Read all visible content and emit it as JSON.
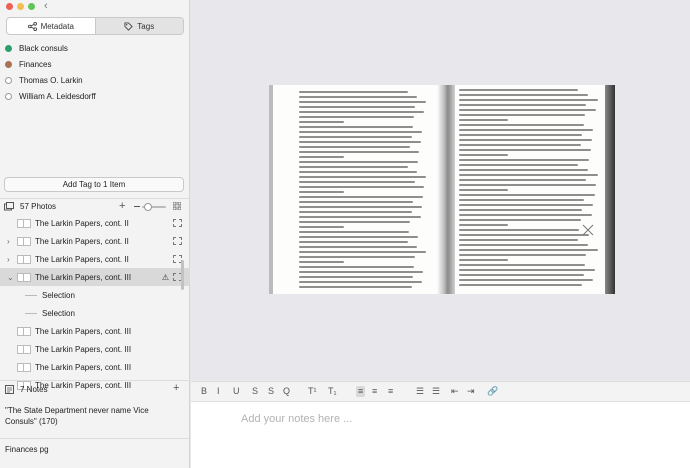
{
  "window": {
    "traffic_colors": [
      "#ee5f57",
      "#f4bd4f",
      "#60c554"
    ],
    "back_icon": "chevron-left-icon",
    "back_glyph": "‹"
  },
  "sidebar": {
    "tabs": [
      {
        "label": "Metadata",
        "icon": "share-nodes-icon",
        "active": false
      },
      {
        "label": "Tags",
        "icon": "tag-icon",
        "active": true
      }
    ],
    "tags": [
      {
        "label": "Black consuls",
        "color": "#2e9e6e",
        "filled": true
      },
      {
        "label": "Finances",
        "color": "#a87355",
        "filled": true
      },
      {
        "label": "Thomas O. Larkin",
        "color": "#ffffff",
        "filled": false
      },
      {
        "label": "William A. Leidesdorff",
        "color": "#ffffff",
        "filled": false
      }
    ],
    "add_tag_label": "Add Tag to 1 Item",
    "photos": {
      "count_label": "57 Photos",
      "plus": "+",
      "rows": [
        {
          "label": "The Larkin Papers, cont. II",
          "indent": 0,
          "chevron": "",
          "selected": false,
          "warn": false,
          "box": true
        },
        {
          "label": "The Larkin Papers, cont. II",
          "indent": 1,
          "chevron": "›",
          "selected": false,
          "warn": false,
          "box": true
        },
        {
          "label": "The Larkin Papers, cont. II",
          "indent": 1,
          "chevron": "›",
          "selected": false,
          "warn": false,
          "box": true
        },
        {
          "label": "The Larkin Papers, cont. III",
          "indent": 1,
          "chevron": "⌄",
          "selected": true,
          "warn": true,
          "box": true
        },
        {
          "label": "Selection",
          "indent": 2,
          "chevron": "",
          "selected": false,
          "warn": false,
          "box": false
        },
        {
          "label": "Selection",
          "indent": 2,
          "chevron": "",
          "selected": false,
          "warn": false,
          "box": false
        },
        {
          "label": "The Larkin Papers, cont. III",
          "indent": 0,
          "chevron": "",
          "selected": false,
          "warn": false,
          "box": false
        },
        {
          "label": "The Larkin Papers, cont. III",
          "indent": 0,
          "chevron": "",
          "selected": false,
          "warn": false,
          "box": false
        },
        {
          "label": "The Larkin Papers, cont. III",
          "indent": 0,
          "chevron": "",
          "selected": false,
          "warn": false,
          "box": false
        },
        {
          "label": "The Larkin Papers, cont. III",
          "indent": 0,
          "chevron": "",
          "selected": false,
          "warn": false,
          "box": false
        }
      ],
      "warn_glyph": "⚠"
    },
    "notes": {
      "count_label": "7 Notes",
      "plus": "+",
      "items": [
        "\"The State Department never name Vice Consuls\" (170)",
        "Finances pg"
      ]
    }
  },
  "editor": {
    "toolbar": [
      "B",
      "I",
      "U",
      "S",
      "S",
      "Q",
      "T¹",
      "T₁",
      "≡",
      "≡",
      "≡",
      "☰",
      "☰",
      "⇤",
      "⇥",
      "🔗"
    ],
    "active_index": 8,
    "placeholder": "Add your notes here ..."
  }
}
